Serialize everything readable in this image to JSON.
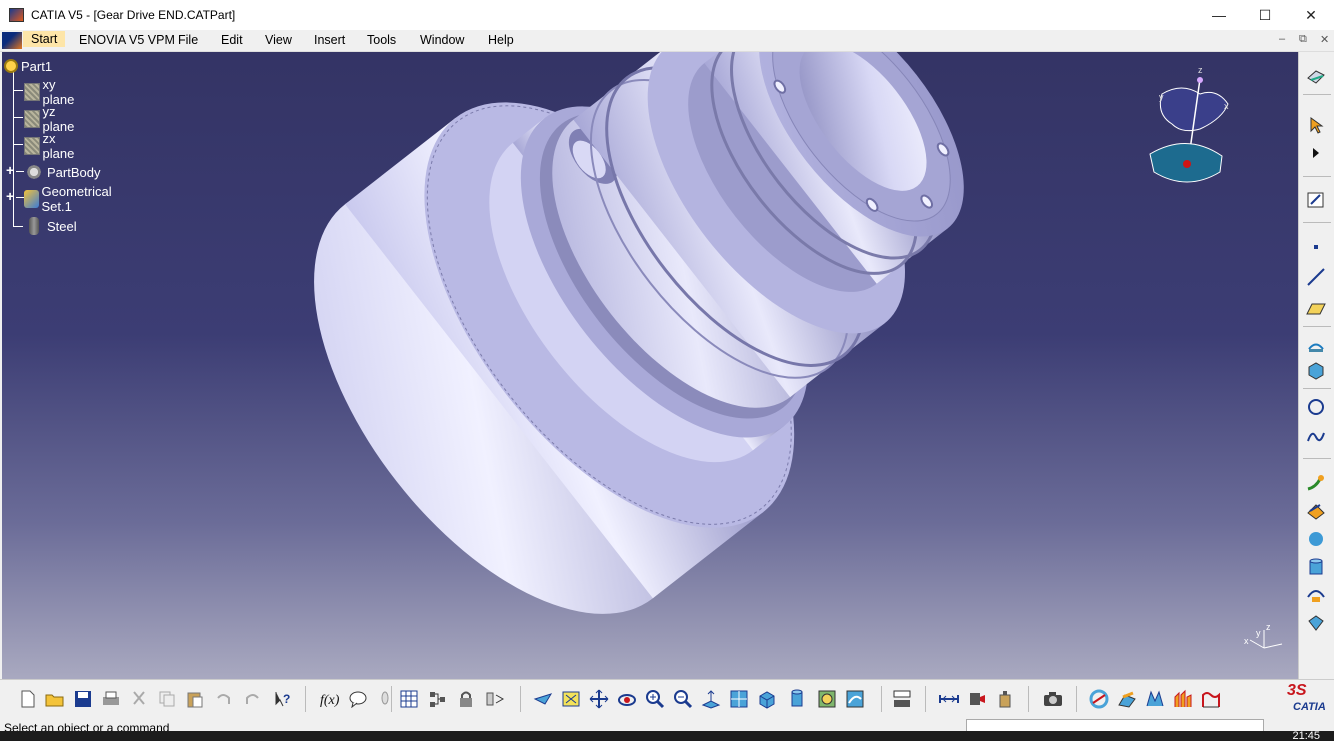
{
  "window": {
    "title": "CATIA V5 - [Gear Drive END.CATPart]",
    "minimize": "—",
    "maximize": "☐",
    "close": "✕"
  },
  "menubar": {
    "items": [
      "Start",
      "ENOVIA V5 VPM",
      "File",
      "Edit",
      "View",
      "Insert",
      "Tools",
      "Window",
      "Help"
    ],
    "mdi_minimize": "–",
    "mdi_restore": "⧉",
    "mdi_close": "✕"
  },
  "tree": {
    "root": "Part1",
    "items": [
      {
        "label": "xy plane",
        "icon": "plane-icon"
      },
      {
        "label": "yz plane",
        "icon": "plane-icon"
      },
      {
        "label": "zx plane",
        "icon": "plane-icon"
      },
      {
        "label": "PartBody",
        "icon": "partbody-icon",
        "expandable": true
      },
      {
        "label": "Geometrical Set.1",
        "icon": "geometrical-set-icon",
        "expandable": true
      },
      {
        "label": "Steel",
        "icon": "material-icon"
      }
    ]
  },
  "compass": {
    "x": "x",
    "y": "y",
    "z": "z"
  },
  "axis_mini": {
    "x": "x",
    "y": "y",
    "z": "z"
  },
  "right_toolbar_icons": [
    "sketcher-icon",
    "select-arrow-icon",
    "expand-arrow-icon",
    "sketch-icon",
    "point-icon",
    "line-icon",
    "plane-icon",
    "extrude-icon",
    "revolve-icon",
    "circle-icon",
    "spline-icon",
    "sweep-icon",
    "multi-section-icon",
    "sphere-icon",
    "cylinder-icon",
    "offset-icon",
    "fill-icon"
  ],
  "bottom_toolbar_icons": [
    "new-icon",
    "open-icon",
    "save-icon",
    "print-icon",
    "cut-icon",
    "copy-icon",
    "paste-icon",
    "undo-icon",
    "redo-icon",
    "whats-this-icon",
    "formula-icon",
    "comment-icon",
    "knowledge-icon",
    "grid-icon",
    "tree-icon",
    "lock-icon",
    "snap-icon",
    "fly-icon",
    "fit-all-icon",
    "pan-icon",
    "rotate-icon",
    "zoom-in-icon",
    "zoom-out-icon",
    "normal-view-icon",
    "iso-view-icon",
    "views-icon",
    "hide-show-icon",
    "render-style-icon",
    "swap-space-icon",
    "measure-between-icon",
    "measure-item-icon",
    "measure-inertia-icon",
    "capture-icon",
    "analysis-1-icon",
    "analysis-2-icon",
    "analysis-3-icon",
    "analysis-4-icon",
    "analysis-5-icon"
  ],
  "logo": {
    "ds": "3S",
    "name": "CATIA"
  },
  "status": {
    "text": "Select an object or a command"
  },
  "taskbar": {
    "clock": "21:45"
  }
}
